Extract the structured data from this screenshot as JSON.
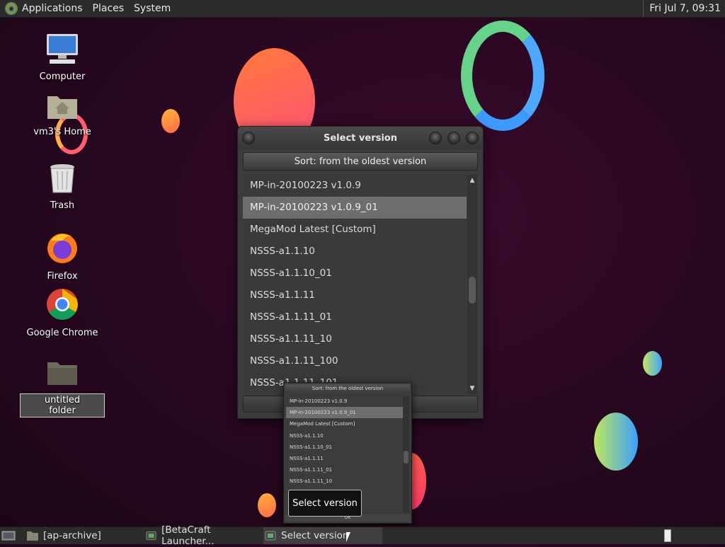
{
  "top_panel": {
    "menus": [
      "Applications",
      "Places",
      "System"
    ],
    "clock": "Fri Jul  7, 09:31"
  },
  "desktop": {
    "icons": [
      {
        "label": "Computer",
        "icon": "computer-icon"
      },
      {
        "label": "vm3's Home",
        "icon": "home-folder-icon"
      },
      {
        "label": "Trash",
        "icon": "trash-icon"
      },
      {
        "label": "Firefox",
        "icon": "firefox-icon"
      },
      {
        "label": "Google Chrome",
        "icon": "chrome-icon"
      },
      {
        "label": "untitled folder",
        "icon": "folder-icon"
      }
    ]
  },
  "dialog": {
    "title": "Select version",
    "sort_label": "Sort: from the oldest version",
    "versions": [
      "MP-in-20100223 v1.0.9",
      "MP-in-20100223 v1.0.9_01",
      "MegaMod Latest [Custom]",
      "NSSS-a1.1.10",
      "NSSS-a1.1.10_01",
      "NSSS-a1.1.11",
      "NSSS-a1.1.11_01",
      "NSSS-a1.1.11_10",
      "NSSS-a1.1.11_100",
      "NSSS-a1.1.11_101"
    ],
    "selected_index": 1
  },
  "preview": {
    "sort_label": "Sort: from the oldest version",
    "versions": [
      "MP-in-20100223 v1.0.9",
      "MP-in-20100223 v1.0.9_01",
      "MegaMod Latest [Custom]",
      "NSSS-a1.1.10",
      "NSSS-a1.1.10_01",
      "NSSS-a1.1.11",
      "NSSS-a1.1.11_01",
      "NSSS-a1.1.11_10"
    ],
    "ok_label": "OK",
    "tooltip": "Select version"
  },
  "taskbar": {
    "tasks": [
      {
        "label": "[ap-archive]",
        "icon": "folder-icon"
      },
      {
        "label": "[BetaCraft Launcher...",
        "icon": "java-icon"
      },
      {
        "label": "Select version",
        "icon": "java-icon"
      }
    ]
  },
  "colors": {
    "background": "#2a0822",
    "panel": "#2b2b2b",
    "selected_row": "#6e6e6e"
  }
}
